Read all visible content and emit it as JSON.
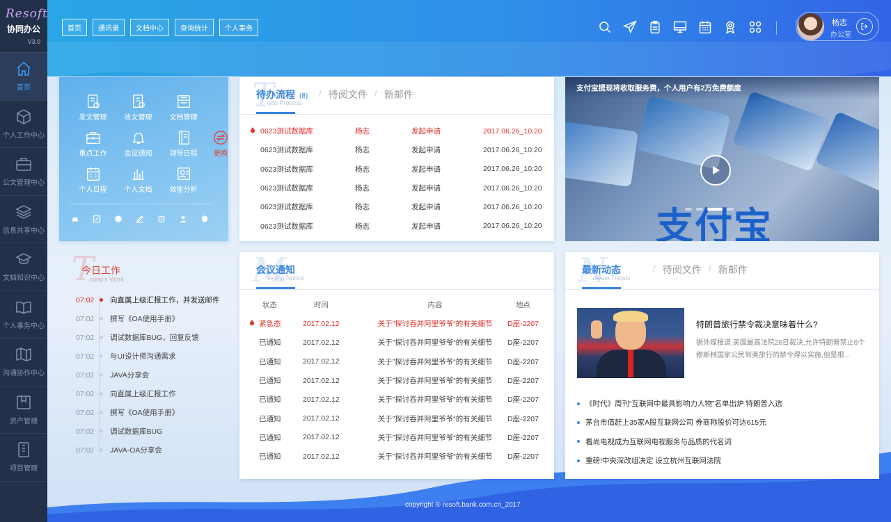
{
  "app": {
    "brand": "Resoft",
    "name": "协同办公",
    "version": "V3.0"
  },
  "sidebar": {
    "items": [
      {
        "label": "首页",
        "icon": "home-icon",
        "active": true
      },
      {
        "label": "个人工作中心",
        "icon": "cube-icon"
      },
      {
        "label": "公文管理中心",
        "icon": "briefcase-icon"
      },
      {
        "label": "信息共享中心",
        "icon": "layers-icon"
      },
      {
        "label": "文档知识中心",
        "icon": "graduation-cap-icon"
      },
      {
        "label": "个人事务中心",
        "icon": "book-icon"
      },
      {
        "label": "沟通协作中心",
        "icon": "map-icon"
      },
      {
        "label": "资产管理",
        "icon": "archive-icon"
      },
      {
        "label": "项目管理",
        "icon": "document-icon"
      }
    ]
  },
  "topnav": [
    "首页",
    "通讯录",
    "文档中心",
    "查询统计",
    "个人事务"
  ],
  "top_icons": [
    "search-icon",
    "send-icon",
    "clipboard-icon",
    "monitor-icon",
    "calendar-icon",
    "award-icon",
    "apps-grid-icon"
  ],
  "user": {
    "name": "杨志",
    "office": "办公室"
  },
  "quick": {
    "items": [
      {
        "label": "发文管理",
        "icon": "doc-send-icon"
      },
      {
        "label": "收文管理",
        "icon": "doc-receive-icon"
      },
      {
        "label": "文档管理",
        "icon": "folder-doc-icon"
      },
      {
        "label": "",
        "icon": "none"
      },
      {
        "label": "重点工作",
        "icon": "toolbox-icon"
      },
      {
        "label": "会议通知",
        "icon": "bell-icon"
      },
      {
        "label": "领导日程",
        "icon": "notebook-icon"
      },
      {
        "label": "更换",
        "icon": "swap-icon"
      },
      {
        "label": "个人日程",
        "icon": "calendar-grid-icon"
      },
      {
        "label": "个人文档",
        "icon": "bar-chart-icon"
      },
      {
        "label": "效能分析",
        "icon": "id-card-icon"
      }
    ],
    "bottom_icons": [
      "car-icon",
      "edit-icon",
      "box-icon",
      "pen-icon",
      "alarm-icon",
      "user-icon",
      "badge-icon"
    ]
  },
  "todo": {
    "big_letter": "T",
    "title": "待办流程",
    "count": "(8)",
    "subtitle_en": "odo Process",
    "tabs": [
      "待阅文件",
      "新邮件"
    ],
    "rows": [
      {
        "name": "0623测试数据库",
        "user": "杨志",
        "action": "发起申请",
        "time": "2017.06.26_10:20",
        "urgent": true
      },
      {
        "name": "0623测试数据库",
        "user": "杨志",
        "action": "发起申请",
        "time": "2017.06.26_10:20"
      },
      {
        "name": "0623测试数据库",
        "user": "杨志",
        "action": "发起申请",
        "time": "2017.06.26_10:20"
      },
      {
        "name": "0623测试数据库",
        "user": "杨志",
        "action": "发起申请",
        "time": "2017.06.26_10:20"
      },
      {
        "name": "0623测试数据库",
        "user": "杨志",
        "action": "发起申请",
        "time": "2017.06.26_10:20"
      },
      {
        "name": "0623测试数据库",
        "user": "杨志",
        "action": "发起申请",
        "time": "2017.06.26_10:20"
      }
    ]
  },
  "banner": {
    "caption": "支付宝提现将收取服务费，个人用户有2万免费额度",
    "logo_text": "支付宝",
    "card_text": "银联"
  },
  "today": {
    "big_letter": "T",
    "title": "今日工作",
    "subtitle_en": "oday's Work",
    "items": [
      {
        "time": "07:02",
        "text": "向直属上级汇报工作，并发送邮件"
      },
      {
        "time": "07:02",
        "text": "撰写《OA使用手册》"
      },
      {
        "time": "07:02",
        "text": "调试数据库BUG，回复反馈"
      },
      {
        "time": "07:02",
        "text": "与UI设计师沟通需求"
      },
      {
        "time": "07:02",
        "text": "JAVA分享会"
      },
      {
        "time": "07:02",
        "text": "向直属上级汇报工作"
      },
      {
        "time": "07:02",
        "text": "撰写《OA使用手册》"
      },
      {
        "time": "07:02",
        "text": "调试数据库BUG"
      },
      {
        "time": "07:02",
        "text": "JAVA-OA分享会"
      }
    ]
  },
  "meeting": {
    "big_letter": "M",
    "title": "会议通知",
    "subtitle_en": "eeting Notice",
    "headers": [
      "状态",
      "时间",
      "内容",
      "地点"
    ],
    "rows": [
      {
        "status": "紧急态",
        "date": "2017.02.12",
        "content": "关于”探讨吞并阿里爷爷“的有关细节",
        "place": "D座-2207",
        "urgent": true
      },
      {
        "status": "已通知",
        "date": "2017.02.12",
        "content": "关于”探讨吞并阿里爷爷“的有关细节",
        "place": "D座-2207"
      },
      {
        "status": "已通知",
        "date": "2017.02.12",
        "content": "关于”探讨吞并阿里爷爷“的有关细节",
        "place": "D座-2207"
      },
      {
        "status": "已通知",
        "date": "2017.02.12",
        "content": "关于”探讨吞并阿里爷爷“的有关细节",
        "place": "D座-2207"
      },
      {
        "status": "已通知",
        "date": "2017.02.12",
        "content": "关于”探讨吞并阿里爷爷“的有关细节",
        "place": "D座-2207"
      },
      {
        "status": "已通知",
        "date": "2017.02.12",
        "content": "关于”探讨吞并阿里爷爷“的有关细节",
        "place": "D座-2207"
      },
      {
        "status": "已通知",
        "date": "2017.02.12",
        "content": "关于”探讨吞并阿里爷爷“的有关细节",
        "place": "D座-2207"
      },
      {
        "status": "已通知",
        "date": "2017.02.12",
        "content": "关于”探讨吞并阿里爷爷“的有关细节",
        "place": "D座-2207"
      }
    ]
  },
  "news": {
    "big_letter": "N",
    "title": "最新动态",
    "subtitle_en": "ewest Trends",
    "tabs": [
      "待阅文件",
      "新邮件"
    ],
    "featured": {
      "title": "特朗普旅行禁令裁决意味着什么?",
      "desc": "据外媒报道,美国最高法院26日裁决,允许特朗普禁止6个穆斯林国家公民到美旅行的禁令得以实施,但是根..."
    },
    "items": [
      "《时代》周刊“互联网中最具影响力人物”名单出炉 特朗普入选",
      "茅台市值赶上35家A股互联网公司 券商称股价可达615元",
      "看尚电视成为互联网电视服务与品质的代名词",
      "重磅!中央深改组决定 设立杭州互联网法院"
    ]
  },
  "footer": {
    "copyright": "copyright ® resoft.bank.com.cn_2017"
  },
  "colors": {
    "accent": "#3a86df",
    "urgent": "#e0302a",
    "sidebar": "#22304a"
  }
}
